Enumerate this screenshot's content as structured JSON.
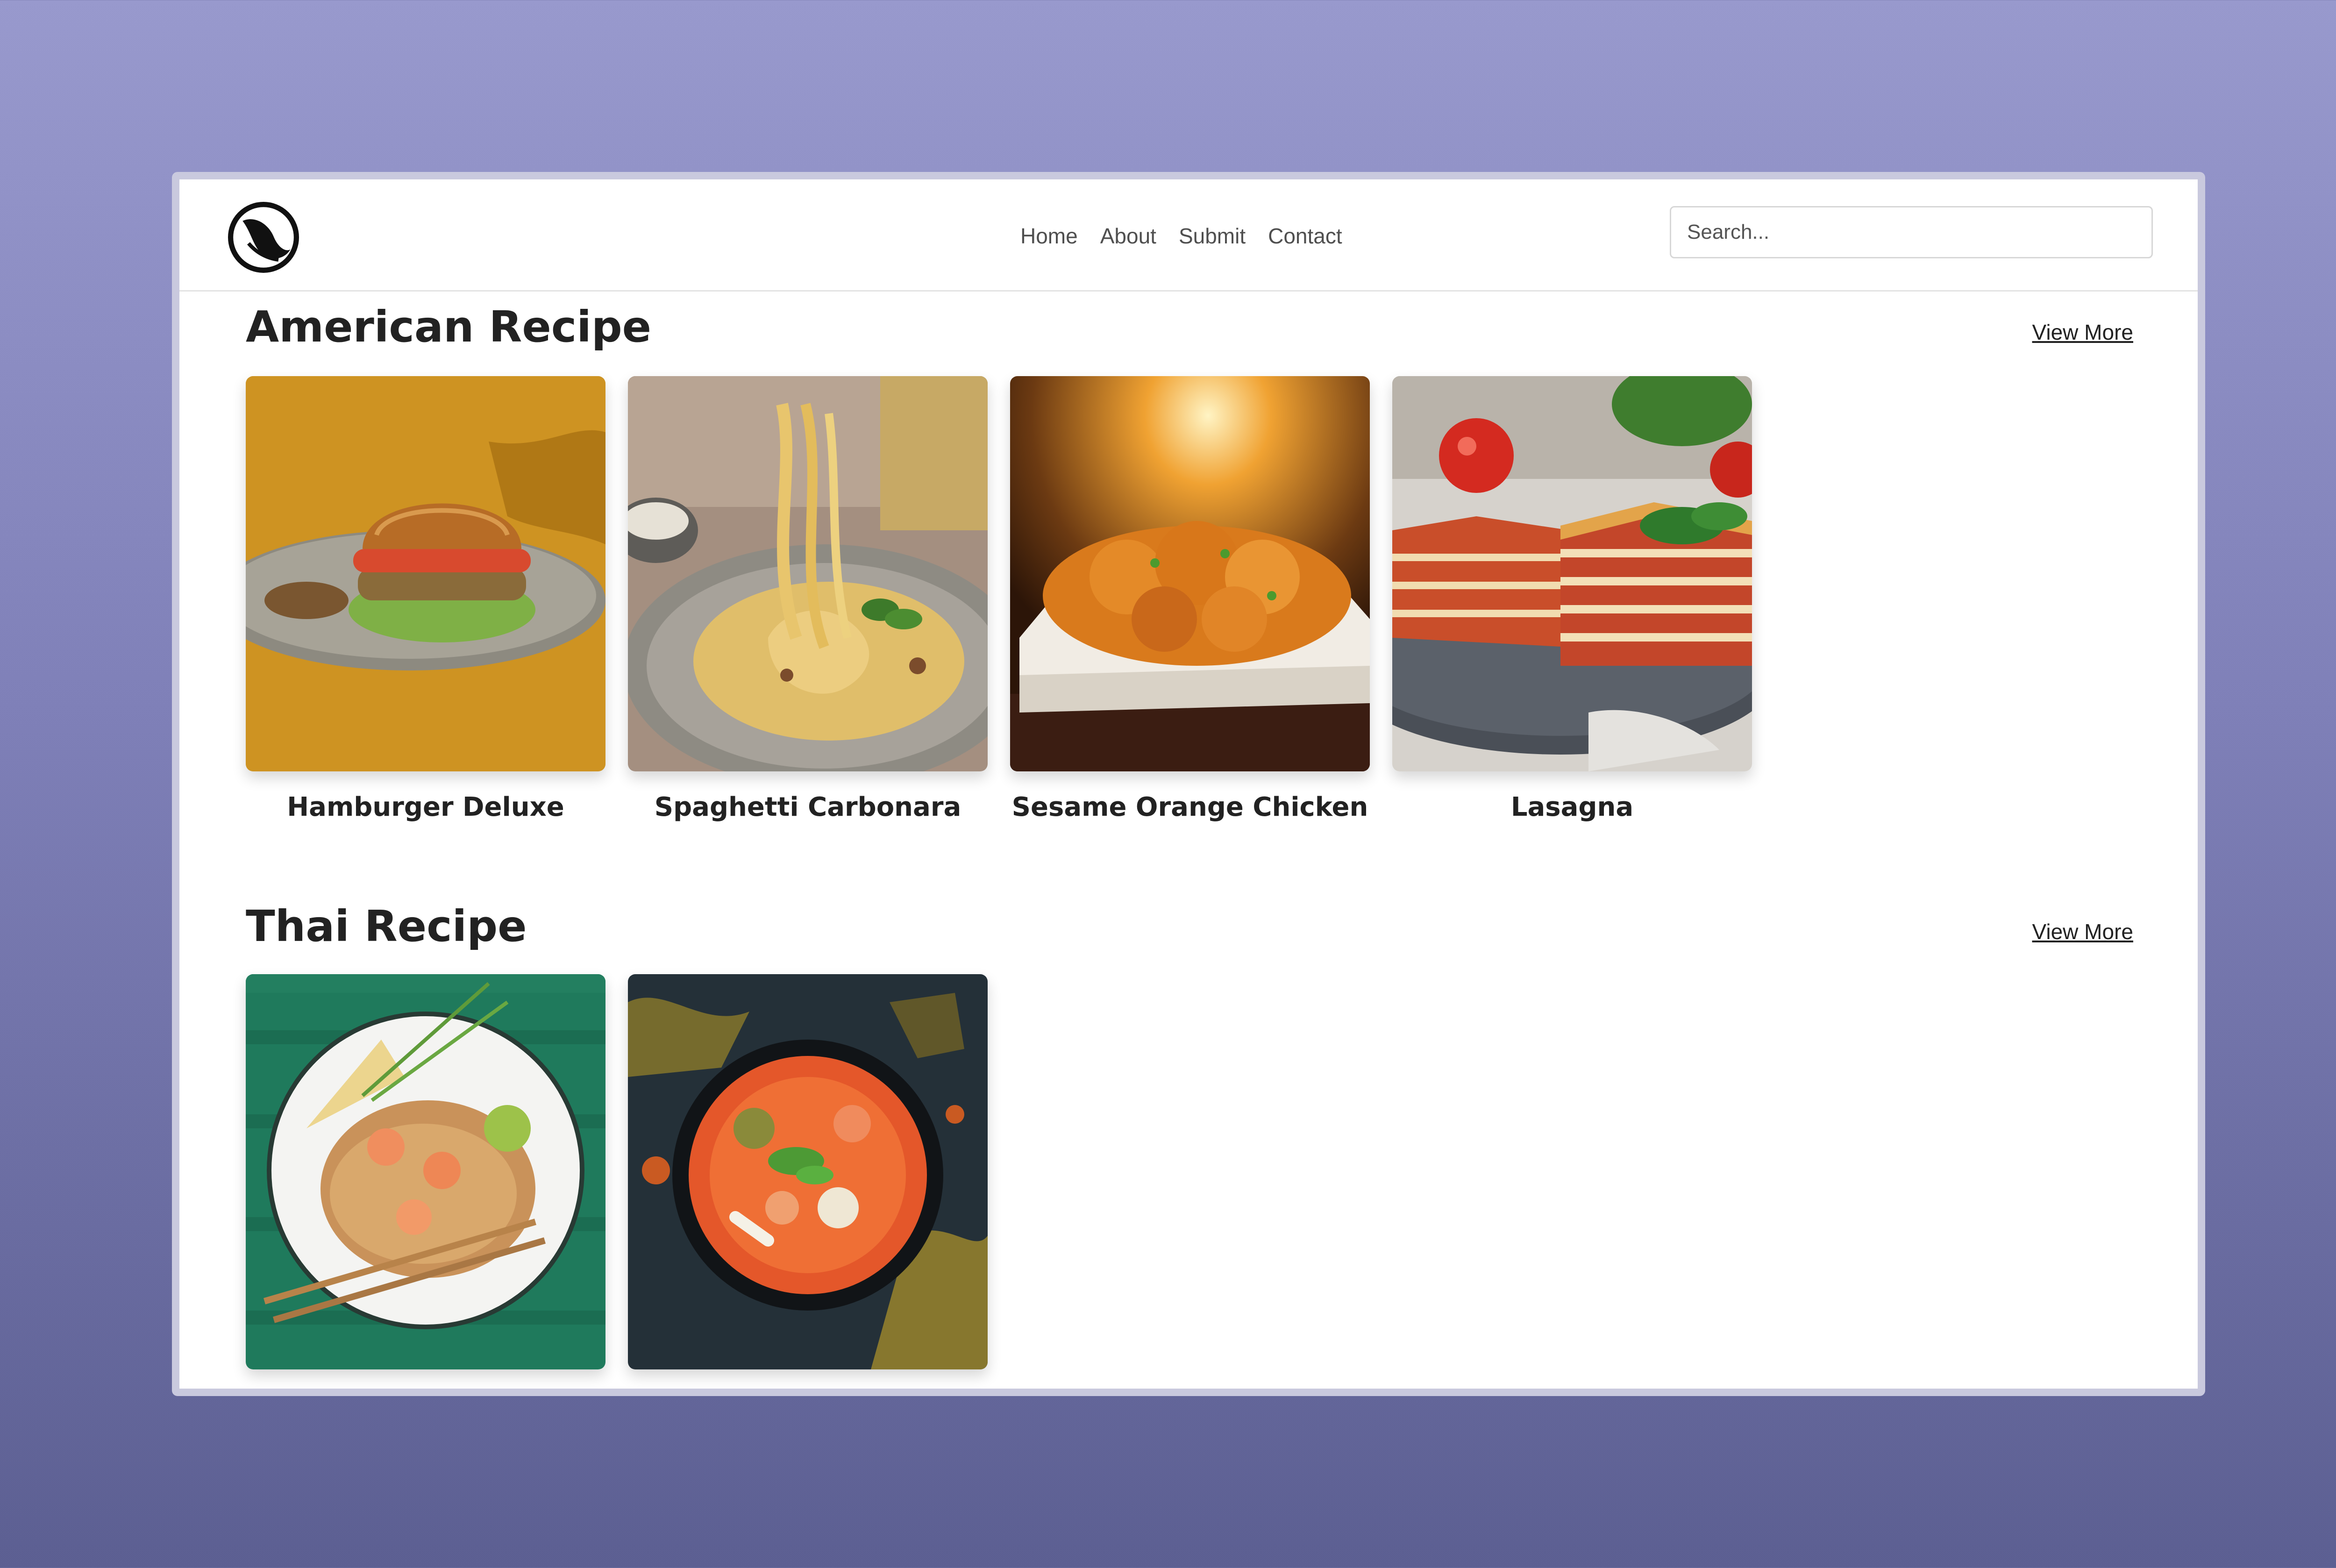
{
  "nav": {
    "links": [
      "Home",
      "About",
      "Submit",
      "Contact"
    ],
    "search_placeholder": "Search..."
  },
  "sections": [
    {
      "title": "American Recipe",
      "view_more": "View More",
      "recipes": [
        {
          "name": "Hamburger Deluxe",
          "image": "hamburger-photo"
        },
        {
          "name": "Spaghetti Carbonara",
          "image": "spaghetti-photo"
        },
        {
          "name": "Sesame Orange Chicken",
          "image": "orange-chicken-photo"
        },
        {
          "name": "Lasagna",
          "image": "lasagna-photo"
        }
      ]
    },
    {
      "title": "Thai Recipe",
      "view_more": "View More",
      "recipes": [
        {
          "name": "",
          "image": "pad-thai-photo"
        },
        {
          "name": "",
          "image": "tom-yum-photo"
        }
      ]
    }
  ],
  "colors": {
    "background_top": "#9899cd",
    "background_bottom": "#5c5f92",
    "text": "#222222"
  }
}
